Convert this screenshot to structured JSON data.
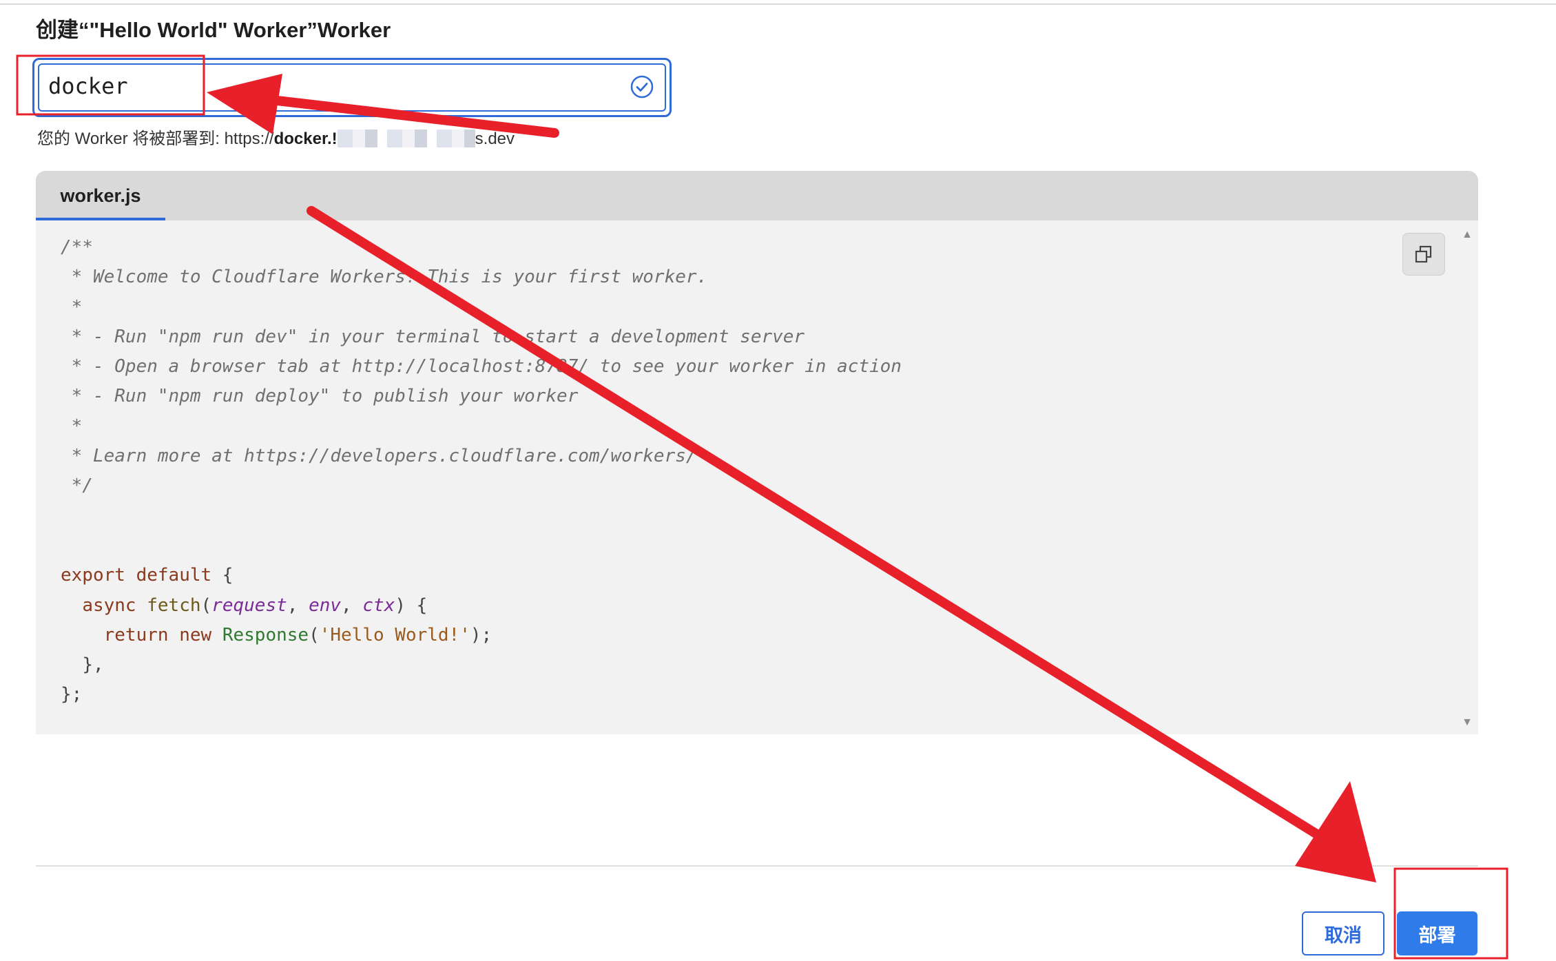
{
  "page": {
    "title": "创建“\"Hello World\" Worker”Worker"
  },
  "name_field": {
    "value": "docker",
    "valid_icon": "check-circle-icon"
  },
  "deploy_url": {
    "prefix": "您的 Worker 将被部署到: https://",
    "host": "docker.!",
    "suffix": "s.dev"
  },
  "editor": {
    "tabs": [
      {
        "label": "worker.js",
        "active": true
      }
    ],
    "copy_icon": "copy-icon"
  },
  "code_lines": [
    "/**",
    " * Welcome to Cloudflare Workers! This is your first worker.",
    " *",
    " * - Run \"npm run dev\" in your terminal to start a development server",
    " * - Open a browser tab at http://localhost:8787/ to see your worker in action",
    " * - Run \"npm run deploy\" to publish your worker",
    " *",
    " * Learn more at https://developers.cloudflare.com/workers/",
    " */",
    "",
    "",
    "export default {",
    "  async fetch(request, env, ctx) {",
    "    return new Response('Hello World!');",
    "  },",
    "};"
  ],
  "code_tokens": {
    "export": "export",
    "default": "default",
    "open_brace": " {",
    "async": "async",
    "fetch": "fetch",
    "request": "request",
    "env": "env",
    "ctx": "ctx",
    "return": "return",
    "new": "new",
    "response": "Response",
    "string": "'Hello World!'",
    "close_inner": "},",
    "close_outer": "};"
  },
  "footer": {
    "cancel_label": "取消",
    "deploy_label": "部署"
  },
  "colors": {
    "accent": "#2f7bea",
    "annotation": "#e8202a"
  }
}
